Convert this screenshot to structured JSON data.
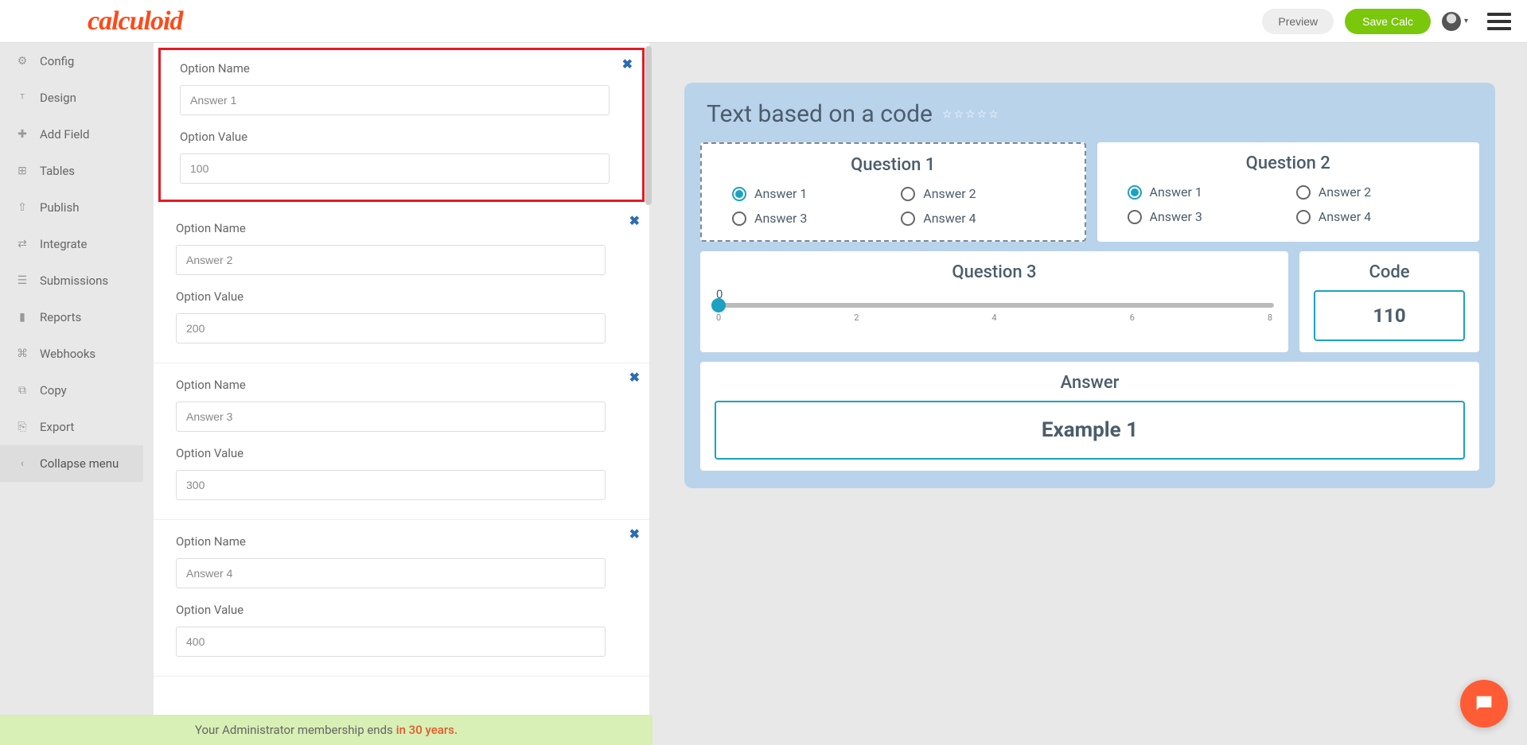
{
  "header": {
    "logo": "calculoid",
    "preview": "Preview",
    "save": "Save Calc"
  },
  "sidebar": {
    "items": [
      {
        "label": "Config",
        "icon": "gear"
      },
      {
        "label": "Design",
        "icon": "design"
      },
      {
        "label": "Add Field",
        "icon": "plus"
      },
      {
        "label": "Tables",
        "icon": "table"
      },
      {
        "label": "Publish",
        "icon": "upload"
      },
      {
        "label": "Integrate",
        "icon": "integrate"
      },
      {
        "label": "Submissions",
        "icon": "inbox"
      },
      {
        "label": "Reports",
        "icon": "chart"
      },
      {
        "label": "Webhooks",
        "icon": "webhook"
      },
      {
        "label": "Copy",
        "icon": "copy"
      },
      {
        "label": "Export",
        "icon": "export"
      },
      {
        "label": "Collapse menu",
        "icon": "collapse"
      }
    ]
  },
  "editor": {
    "options": [
      {
        "name_label": "Option Name",
        "name_value": "Answer 1",
        "value_label": "Option Value",
        "value_value": "100",
        "highlighted": true
      },
      {
        "name_label": "Option Name",
        "name_value": "Answer 2",
        "value_label": "Option Value",
        "value_value": "200",
        "highlighted": false
      },
      {
        "name_label": "Option Name",
        "name_value": "Answer 3",
        "value_label": "Option Value",
        "value_value": "300",
        "highlighted": false
      },
      {
        "name_label": "Option Name",
        "name_value": "Answer 4",
        "value_label": "Option Value",
        "value_value": "400",
        "highlighted": false
      }
    ]
  },
  "preview": {
    "title": "Text based on a code",
    "q1": {
      "title": "Question 1",
      "answers": [
        "Answer 1",
        "Answer 2",
        "Answer 3",
        "Answer 4"
      ],
      "selected": 0
    },
    "q2": {
      "title": "Question 2",
      "answers": [
        "Answer 1",
        "Answer 2",
        "Answer 3",
        "Answer 4"
      ],
      "selected": 0
    },
    "q3": {
      "title": "Question 3",
      "value": "0",
      "ticks": [
        "0",
        "2",
        "4",
        "6",
        "8"
      ]
    },
    "code": {
      "title": "Code",
      "value": "110"
    },
    "answer": {
      "title": "Answer",
      "value": "Example 1"
    }
  },
  "footer": {
    "text": "Your Administrator membership ends",
    "highlight": "in 30 years."
  }
}
